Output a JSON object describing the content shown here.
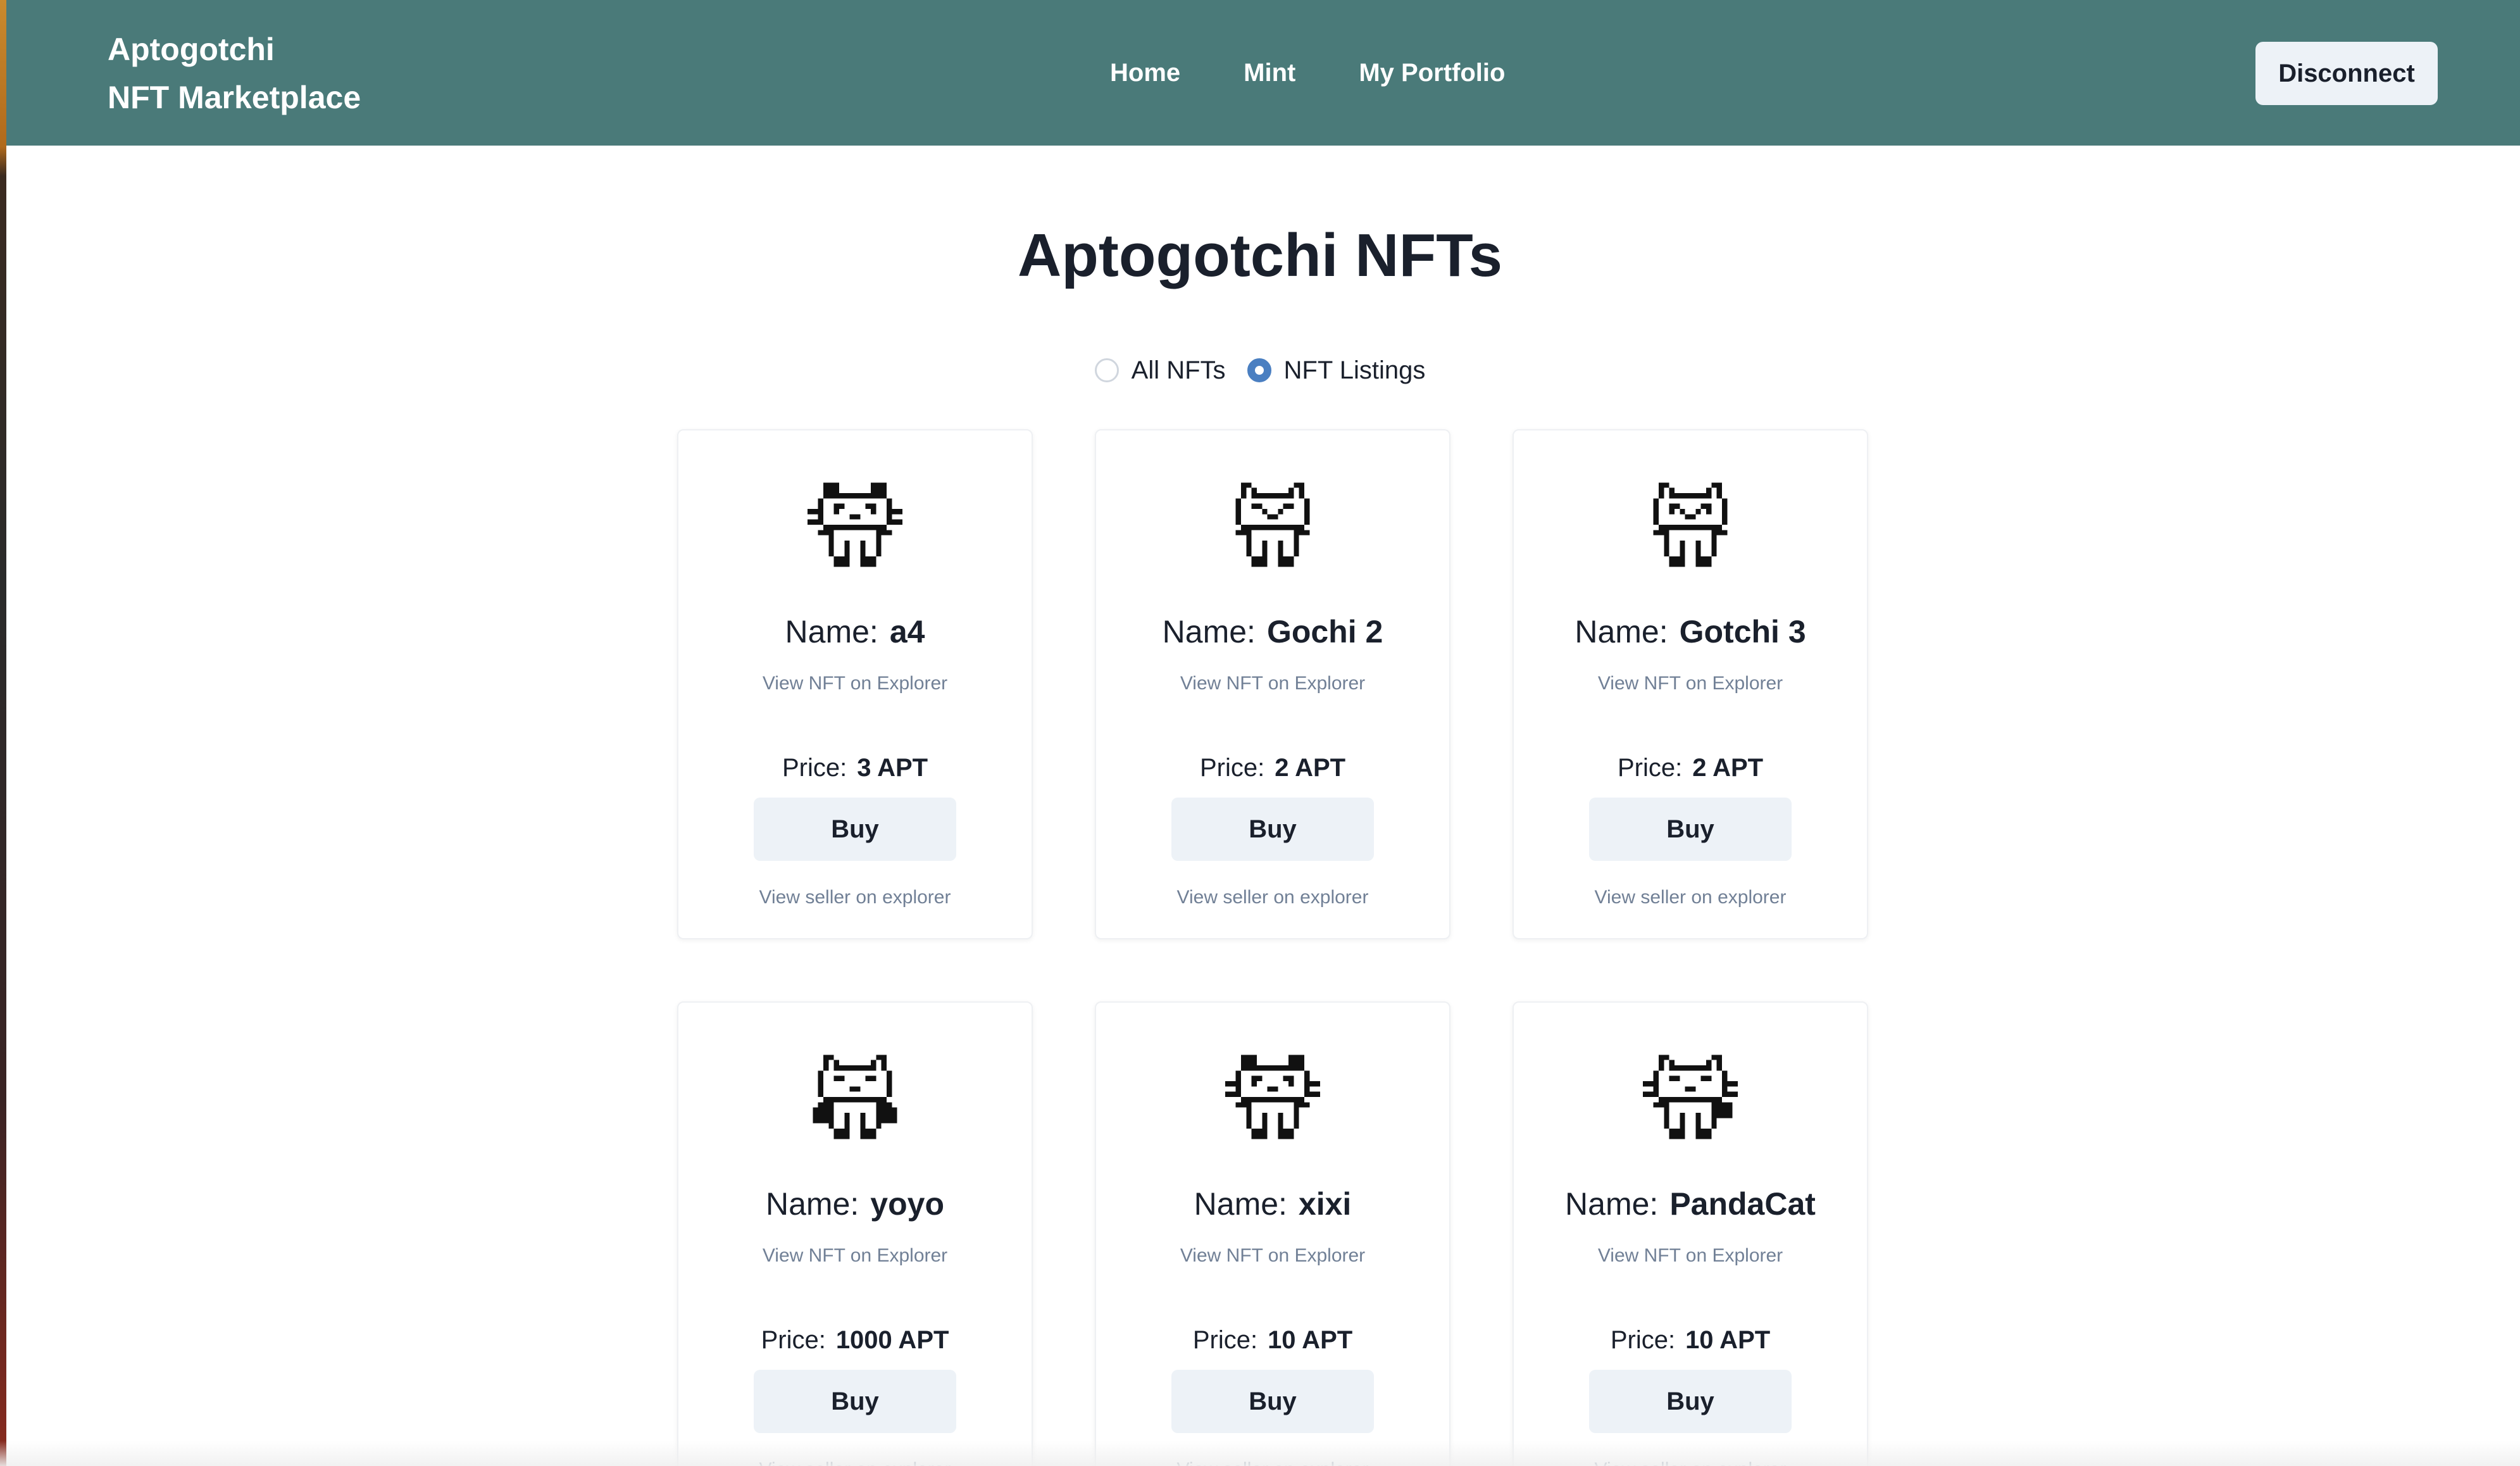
{
  "header": {
    "brand_line1": "Aptogotchi",
    "brand_line2": "NFT Marketplace",
    "nav": [
      {
        "label": "Home"
      },
      {
        "label": "Mint"
      },
      {
        "label": "My Portfolio"
      }
    ],
    "disconnect_label": "Disconnect",
    "background_color": "#4a7a79"
  },
  "main": {
    "title": "Aptogotchi NFTs",
    "filter": {
      "options": [
        {
          "label": "All NFTs",
          "checked": false
        },
        {
          "label": "NFT Listings",
          "checked": true
        }
      ],
      "accent_color": "#4a7fc1"
    },
    "labels": {
      "name_prefix": "Name:",
      "price_prefix": "Price:",
      "explorer_link": "View NFT on Explorer",
      "buy": "Buy",
      "seller_link": "View seller on explorer"
    },
    "cards": [
      {
        "name": "a4",
        "price": "3 APT",
        "icon": "pixel-cat-pet-icon"
      },
      {
        "name": "Gochi 2",
        "price": "2 APT",
        "icon": "pixel-cat-pet-icon"
      },
      {
        "name": "Gotchi 3",
        "price": "2 APT",
        "icon": "pixel-cat-pet-icon"
      },
      {
        "name": "yoyo",
        "price": "1000 APT",
        "icon": "pixel-cat-pet-icon"
      },
      {
        "name": "xixi",
        "price": "10 APT",
        "icon": "pixel-cat-pet-icon"
      },
      {
        "name": "PandaCat",
        "price": "10 APT",
        "icon": "pixel-cat-pet-icon"
      }
    ]
  }
}
